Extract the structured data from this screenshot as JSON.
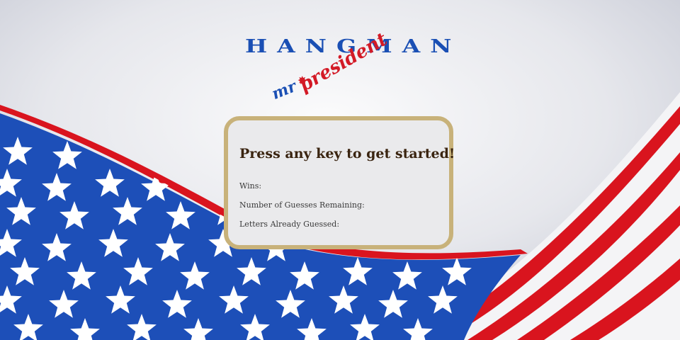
{
  "logo": {
    "word": "HANGMAN",
    "sub_prefix": "mr",
    "sub_word": "president"
  },
  "card": {
    "title": "Press any key to get started!",
    "wins_label": "Wins:",
    "wins_value": "",
    "guesses_label": "Number of Guesses Remaining:",
    "guesses_value": "",
    "letters_label": "Letters Already Guessed:",
    "letters_value": ""
  },
  "colors": {
    "flag_blue": "#1d4fb8",
    "flag_red": "#d9141e",
    "card_border": "#c8b27a",
    "card_bg": "#eaeaec",
    "title_text": "#3a2410"
  },
  "icons": [
    "flag-background",
    "star-icon"
  ]
}
